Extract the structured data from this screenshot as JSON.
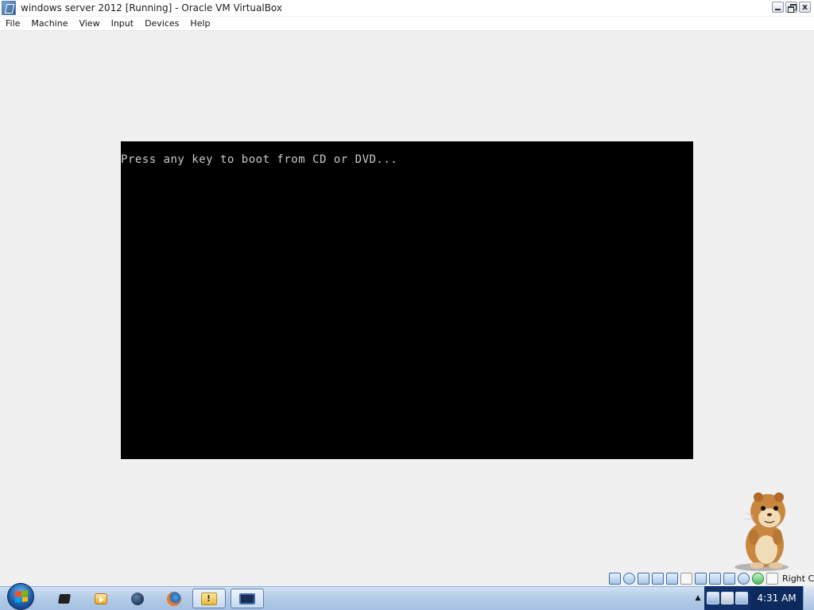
{
  "window": {
    "title": "windows server 2012 [Running] - Oracle VM VirtualBox",
    "icon": "virtualbox-icon",
    "controls": {
      "close_label": "x"
    }
  },
  "menu": {
    "items": [
      "File",
      "Machine",
      "View",
      "Input",
      "Devices",
      "Help"
    ]
  },
  "vm": {
    "boot_message": "Press any key to boot from CD or DVD..."
  },
  "statusbar": {
    "icons": [
      "hard-disk-icon",
      "optical-drive-icon",
      "audio-icon",
      "network-icon",
      "usb-icon",
      "shared-folders-icon",
      "display-icon",
      "video-capture-icon",
      "mouse-integration-icon",
      "cpu-icon",
      "additions-icon",
      "capture-keyboard-icon"
    ],
    "host_key": "Right Ctrl"
  },
  "taskbar": {
    "apps": [
      "cube-app-icon",
      "media-player-icon",
      "globe-app-icon",
      "firefox-icon",
      "folder-icon",
      "virtualbox-icon"
    ],
    "tray_arrow": "▲",
    "clock": "4:31 AM"
  },
  "colors": {
    "vm_background": "#000000",
    "vm_text": "#c8c8c8",
    "app_background": "#f0f0f0",
    "taskbar": "#b3cbe7",
    "tray": "#10316b"
  }
}
